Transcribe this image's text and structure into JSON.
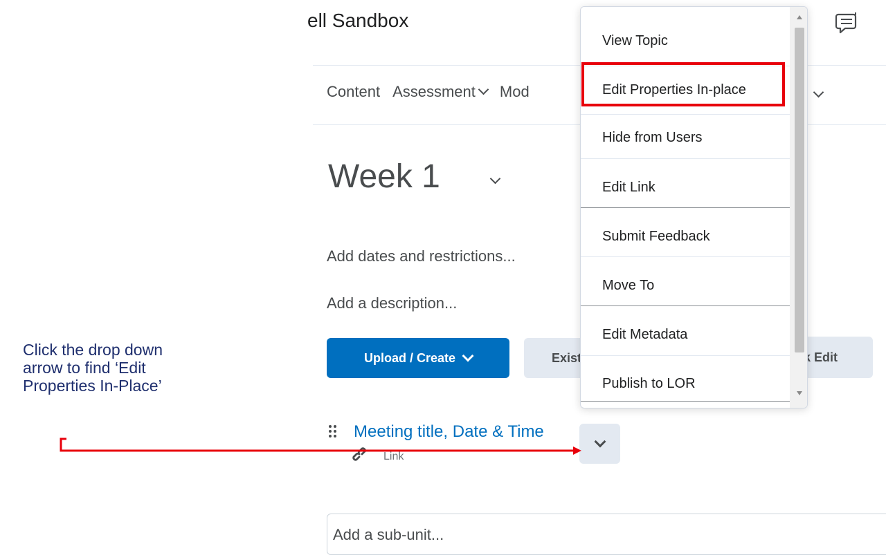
{
  "header": {
    "course_title": "ell Sandbox",
    "chat_icon": "chat-bubble-icon"
  },
  "nav": {
    "content": "Content",
    "assessment": "Assessment",
    "modules_partial": "Mod"
  },
  "week": {
    "title": "Week 1"
  },
  "actions": {
    "add_dates": "Add dates and restrictions...",
    "add_description": "Add a description...",
    "upload_create": "Upload / Create",
    "existing_partial": "Exist",
    "bulk_edit_partial": "lk Edit"
  },
  "topic": {
    "title": "Meeting title, Date & Time",
    "type_label": "Link",
    "icon": "link-icon"
  },
  "subunit": {
    "placeholder": "Add a sub-unit..."
  },
  "menu": {
    "items": [
      "View Topic",
      "Edit Properties In-place",
      "Hide from Users",
      "Edit Link",
      "Submit Feedback",
      "Move To",
      "Edit Metadata",
      "Publish to LOR"
    ],
    "highlighted": "Edit Properties In-place"
  },
  "annotation": {
    "text": "Click the drop down arrow to find ‘Edit Properties In-Place’"
  },
  "colors": {
    "primary": "#006fbf",
    "highlight": "#e8000b",
    "annotation_text": "#1f2f6e",
    "button_grey": "#e3e9f1"
  }
}
